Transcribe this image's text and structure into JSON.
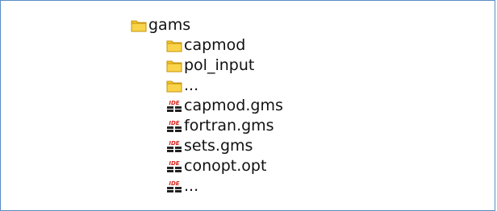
{
  "tree": {
    "root": {
      "label": "gams",
      "icon": "folder-icon"
    },
    "children": [
      {
        "label": "capmod",
        "icon": "folder-icon"
      },
      {
        "label": "pol_input",
        "icon": "folder-icon"
      },
      {
        "label": "...",
        "icon": "folder-icon"
      },
      {
        "label": "capmod.gms",
        "icon": "ide-file-icon"
      },
      {
        "label": "fortran.gms",
        "icon": "ide-file-icon"
      },
      {
        "label": "sets.gms",
        "icon": "ide-file-icon"
      },
      {
        "label": "conopt.opt",
        "icon": "ide-file-icon"
      },
      {
        "label": "...",
        "icon": "ide-file-icon"
      }
    ],
    "ide_icon_text": "IDE"
  },
  "colors": {
    "frame_border": "#5b8cc6",
    "folder_fill": "#f6c62f",
    "folder_edge": "#c6930a",
    "ide_red": "#d7261e",
    "ide_dark": "#222222"
  }
}
